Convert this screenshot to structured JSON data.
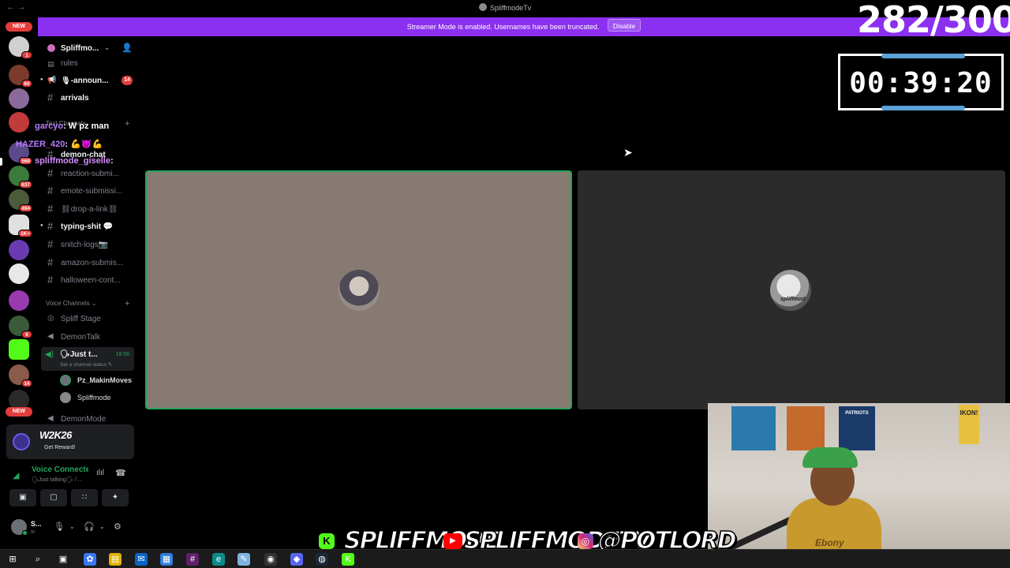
{
  "window": {
    "title": "SpliffmodeTv",
    "nav": "← →"
  },
  "banner": {
    "text": "Streamer Mode is enabled. Usernames have been truncated.",
    "disable_label": "Disable"
  },
  "rail": {
    "new_top": "NEW",
    "new_bottom": "NEW",
    "badges": [
      "1",
      "60",
      "568",
      "637",
      "494",
      "1K+",
      "6",
      "14"
    ]
  },
  "server": {
    "name": "Spliffmo...",
    "chevron": "⌄",
    "invite_icon": "👤"
  },
  "channels": [
    {
      "hash": "▤",
      "label": "rules",
      "bold": false
    },
    {
      "hash": "📢",
      "label": "🎙-announ...",
      "bold": true,
      "mention": "14"
    },
    {
      "hash": "#",
      "label": "arrivals",
      "bold": true
    },
    {
      "hash": "#",
      "label": "demon-chat",
      "bold": true
    },
    {
      "hash": "#",
      "label": "reaction-submi...",
      "bold": false
    },
    {
      "hash": "#",
      "label": "emote-submissi...",
      "bold": false
    },
    {
      "hash": "#",
      "label": "⛓drop-a-link⛓",
      "bold": false
    },
    {
      "hash": "#",
      "label": "typing-shit 💬",
      "bold": true
    },
    {
      "hash": "#",
      "label": "snitch-logs📷",
      "bold": false
    },
    {
      "hash": "#",
      "label": "amazon-submis...",
      "bold": false
    },
    {
      "hash": "#",
      "label": "halloween-cont...",
      "bold": false
    }
  ],
  "categories": {
    "text": "Text Channels",
    "voice": "Voice Channels ⌄"
  },
  "voice_channels": [
    {
      "label": "Spliff Stage"
    },
    {
      "label": "DemonTalk"
    },
    {
      "label": "DemonMode"
    }
  ],
  "active_voice": {
    "name": "🗣Just t...",
    "time": "18:56",
    "status": "Set a channel status ✎",
    "members": [
      "Pz_MakinMoves",
      "Spliffmode"
    ]
  },
  "overlay_chat": [
    {
      "user": "garcyo",
      "text": ": W pz man"
    },
    {
      "user": "HAZER_420",
      "text": ": 💪👿💪"
    },
    {
      "user": "spliffmode_giselle",
      "text": ":"
    }
  ],
  "activity": {
    "game": "W2K26",
    "action": "Get Reward!"
  },
  "voice_panel": {
    "title": "Voice Connecte",
    "subtitle": "🗣Just talking🗣 / ...",
    "buttons": [
      "▣",
      "▢",
      "∷",
      "✦"
    ]
  },
  "user_panel": {
    "name": "S...",
    "status": "In",
    "mic": "🎙",
    "headset": "🎧",
    "settings": "⚙"
  },
  "tiles": [
    {
      "name": "speaking-tile",
      "speaking": true
    },
    {
      "name": "spliffmode-tile",
      "sig": "spliffmod"
    }
  ],
  "stream_overlay": {
    "counter": "282/300",
    "timer": "00:39:20",
    "socials": [
      {
        "platform": "kick",
        "icon": "K",
        "handle": "SPLIFFMODE",
        "color": "#53fc18"
      },
      {
        "platform": "youtube",
        "icon": "▶",
        "handle": "SPLIFFMODETV",
        "color": "#ff0000"
      },
      {
        "platform": "instagram",
        "icon": "◎",
        "handle": "@POTLORD",
        "color": "#d62976"
      }
    ],
    "webcam": {
      "shirt_text": "Ebony",
      "sign_text": "IKON!",
      "poster": "PATRIOTS"
    }
  },
  "taskbar": {
    "items": [
      {
        "name": "start",
        "glyph": "⊞",
        "color": "#1b1b1b"
      },
      {
        "name": "search",
        "glyph": "⌕",
        "color": "#1b1b1b"
      },
      {
        "name": "task-view",
        "glyph": "▣",
        "color": "#1b1b1b"
      },
      {
        "name": "copilot",
        "glyph": "✿",
        "color": "#3a78f2"
      },
      {
        "name": "files",
        "glyph": "▤",
        "color": "#e0b000"
      },
      {
        "name": "outlook",
        "glyph": "✉",
        "color": "#0a64c8"
      },
      {
        "name": "store",
        "glyph": "▦",
        "color": "#2d7de0"
      },
      {
        "name": "slack",
        "glyph": "#",
        "color": "#611f69"
      },
      {
        "name": "edge",
        "glyph": "e",
        "color": "#0c8a8a"
      },
      {
        "name": "notepad",
        "glyph": "✎",
        "color": "#7fb2e0"
      },
      {
        "name": "obs",
        "glyph": "◉",
        "color": "#333"
      },
      {
        "name": "discord",
        "glyph": "◆",
        "color": "#5865f2"
      },
      {
        "name": "steam",
        "glyph": "◍",
        "color": "#1b2838"
      },
      {
        "name": "kick",
        "glyph": "K",
        "color": "#53fc18"
      }
    ]
  },
  "colors": {
    "accent": "#8b2ff0",
    "online": "#23a55a",
    "badge": "#e23c3c"
  }
}
